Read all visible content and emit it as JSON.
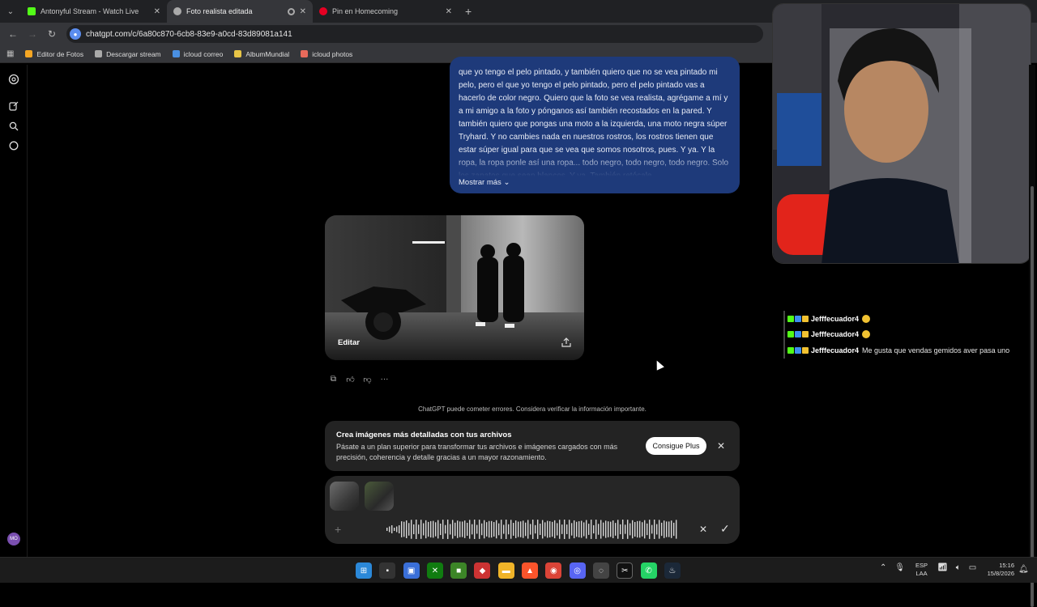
{
  "browser": {
    "tabs": [
      {
        "title": "Antonyful Stream - Watch Live",
        "favicon_color": "#53fc18",
        "favicon": "kick-icon",
        "active": false
      },
      {
        "title": "Foto realista editada",
        "favicon_color": "#aaaaaa",
        "favicon": "chatgpt-icon",
        "active": true
      },
      {
        "title": "Pin en Homecoming",
        "favicon_color": "#e60023",
        "favicon": "pinterest-icon",
        "active": false
      }
    ],
    "url": "chatgpt.com/c/6a80c870-6cb8-83e9-a0cd-83d89081a141",
    "bookmarks": [
      {
        "label": "Editor de Fotos",
        "color": "#f5a623"
      },
      {
        "label": "Descargar stream",
        "color": "#aaaaaa"
      },
      {
        "label": "icloud correo",
        "color": "#4a90e2"
      },
      {
        "label": "AlbumMundial",
        "color": "#e8c547"
      },
      {
        "label": "icloud photos",
        "color": "#e86a5b"
      }
    ]
  },
  "message": {
    "text": "que yo tengo el pelo pintado, y también quiero que no se vea pintado mi pelo, pero el que yo tengo el pelo pintado, pero el pelo pintado vas a hacerlo de color negro. Quiero que la foto se vea realista, agrégame a mí y a mi amigo a la foto y pónganos así también recostados en la pared. Y también quiero que pongas una moto a la izquierda, una moto negra súper Tryhard. Y no cambies nada en nuestros rostros, los rostros tienen que estar súper igual para que se vea que somos nosotros, pues. Y ya. Y la ropa, la ropa ponle así una ropa... todo negro, todo negro, todo negro. Solo los zapatos que sean blancos. Y ya. También retócale",
    "show_more": "Mostrar más"
  },
  "image_card": {
    "edit_label": "Editar"
  },
  "disclaimer": "ChatGPT puede cometer errores. Considera verificar la información importante.",
  "promo": {
    "title": "Crea imágenes más detalladas con tus archivos",
    "body": "Pásate a un plan superior para transformar tus archivos e imágenes cargados con más precisión, coherencia y detalle gracias a un mayor razonamiento.",
    "button": "Consigue Plus"
  },
  "chat": [
    {
      "user": "Jefffecuador4",
      "message": "",
      "emoji": true
    },
    {
      "user": "Jefffecuador4",
      "message": "",
      "emoji": true
    },
    {
      "user": "Jefffecuador4",
      "message": "Me gusta que vendas gemidos aver pasa uno",
      "emoji": false
    }
  ],
  "sidebar": {
    "avatar_initials": "MO"
  },
  "taskbar": {
    "lang_line1": "ESP",
    "lang_line2": "LAA",
    "time": "15:16",
    "date": "15/8/2026"
  }
}
